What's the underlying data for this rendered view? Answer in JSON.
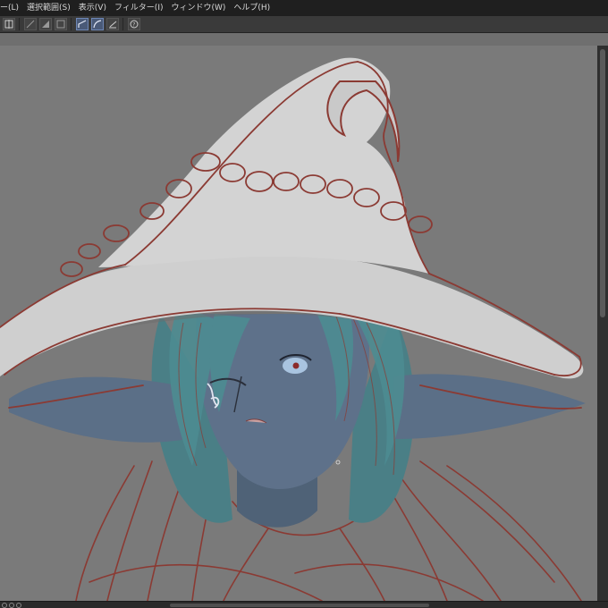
{
  "menubar": {
    "items": [
      "ー(L)",
      "選択範囲(S)",
      "表示(V)",
      "フィルター(I)",
      "ウィンドウ(W)",
      "ヘルプ(H)"
    ]
  },
  "toolbar": {
    "icons": [
      "transform-icon",
      "snap-off-icon",
      "snap-fill-icon",
      "snap-rect-icon",
      "ruler-line-icon",
      "ruler-curve-icon",
      "ruler-special-icon",
      "help-icon"
    ]
  },
  "colors": {
    "canvas_bg": "#7a7a7a",
    "hat": "#cfcfcf",
    "sketch_line": "#8b3a33",
    "skin": "#5c6f86",
    "hair": "#4d8c92"
  }
}
